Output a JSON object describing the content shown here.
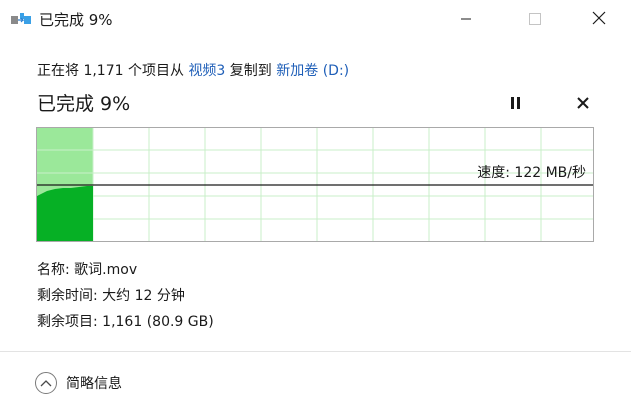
{
  "window": {
    "title": "已完成 9%",
    "icon": "file-copy-icon",
    "controls": {
      "minimize": "minimize-icon",
      "maximize": "maximize-icon",
      "close": "close-icon"
    }
  },
  "copy_info": {
    "prefix": "正在将 1,171 个项目从 ",
    "source": "视频3",
    "middle": " 复制到 ",
    "destination": "新加卷 (D:)"
  },
  "progress": {
    "heading": "已完成 9%",
    "percent": 9,
    "pause_icon": "pause-icon",
    "cancel_icon": "cancel-icon"
  },
  "graph": {
    "speed_label": "速度: 122 MB/秒",
    "fill_color": "#06b025",
    "light_fill_color": "#9be89a",
    "grid_color": "#c9efc9",
    "speed_line_color": "#1a1a1a"
  },
  "details": {
    "name": "名称: 歌词.mov",
    "time_remaining": "剩余时间: 大约 12 分钟",
    "items_remaining": "剩余项目: 1,161 (80.9 GB)"
  },
  "footer": {
    "toggle_label": "简略信息",
    "toggle_icon": "chevron-up-icon"
  }
}
